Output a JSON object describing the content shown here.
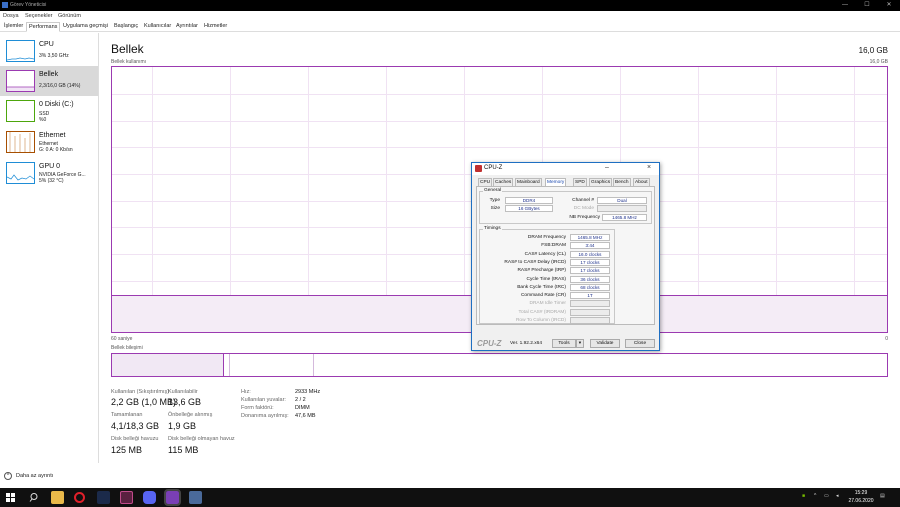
{
  "window": {
    "title": "Görev Yöneticisi",
    "minimize": "—",
    "maximize": "☐",
    "close": "✕"
  },
  "menu": [
    "Dosya",
    "Seçenekler",
    "Görünüm"
  ],
  "tabs": [
    "İşlemler",
    "Performans",
    "Uygulama geçmişi",
    "Başlangıç",
    "Kullanıcılar",
    "Ayrıntılar",
    "Hizmetler"
  ],
  "active_tab": "Performans",
  "sidebar": {
    "items": [
      {
        "title": "CPU",
        "sub1": "3%  3,50 GHz",
        "sub2": "",
        "sub3": "",
        "color": "#1f8dd6"
      },
      {
        "title": "Bellek",
        "sub1": "2,3/16,0 GB (14%)",
        "sub2": "",
        "sub3": "",
        "color": "#9b3ab1"
      },
      {
        "title": "0 Diski (C:)",
        "sub1": "SSD",
        "sub2": "%0",
        "sub3": "",
        "color": "#4da60c"
      },
      {
        "title": "Ethernet",
        "sub1": "Ethernet",
        "sub2": "G: 0  A: 0 Kb/sn",
        "sub3": "",
        "color": "#a74f01"
      },
      {
        "title": "GPU 0",
        "sub1": "NVIDIA GeForce G...",
        "sub2": "5% (32 °C)",
        "sub3": "",
        "color": "#1f8dd6"
      }
    ]
  },
  "main": {
    "title": "Bellek",
    "total": "16,0 GB",
    "usage_label": "Bellek kullanımı",
    "usage_max": "16,0 GB",
    "time_label": "60 saniye",
    "zero_label": "0",
    "composition_label": "Bellek bileşimi",
    "usage_fraction": 0.14
  },
  "stats": {
    "in_use_label": "Kullanılan (Sıkıştırılmış)",
    "in_use": "2,2 GB (1,0 MB)",
    "available_label": "Kullanılabilir",
    "available": "13,6 GB",
    "committed_label": "Tamamlanan",
    "committed": "4,1/18,3 GB",
    "cached_label": "Önbelleğe alınmış",
    "cached": "1,9 GB",
    "paged_label": "Disk belleği havuzu",
    "paged": "125 MB",
    "nonpaged_label": "Disk belleği olmayan havuz",
    "nonpaged": "115 MB"
  },
  "specs": [
    {
      "k": "Hız:",
      "v": "2933 MHz"
    },
    {
      "k": "Kullanılan yuvalar:",
      "v": "2 / 2"
    },
    {
      "k": "Form faktörü:",
      "v": "DIMM"
    },
    {
      "k": "Donanıma ayrılmış:",
      "v": "47,6 MB"
    }
  ],
  "fewer_details": "Daha az ayrıntı",
  "cpuz": {
    "title": "CPU-Z",
    "tabs": [
      "CPU",
      "Caches",
      "Mainboard",
      "Memory",
      "SPD",
      "Graphics",
      "Bench",
      "About"
    ],
    "active_tab": "Memory",
    "general_label": "General",
    "type_label": "Type",
    "type": "DDR4",
    "size_label": "Size",
    "size": "16 GBytes",
    "channel_label": "Channel #",
    "channel": "Dual",
    "dc_label": "DC Mode",
    "dc": "",
    "nb_label": "NB Frequency",
    "nb": "1465.8 MHz",
    "timings_label": "Timings",
    "timings": [
      {
        "k": "DRAM Frequency",
        "v": "1465.8 MHz",
        "dim": false
      },
      {
        "k": "FSB:DRAM",
        "v": "3:44",
        "dim": false
      },
      {
        "k": "CAS# Latency (CL)",
        "v": "16.0 clocks",
        "dim": false
      },
      {
        "k": "RAS# to CAS# Delay (tRCD)",
        "v": "17 clocks",
        "dim": false
      },
      {
        "k": "RAS# Precharge (tRP)",
        "v": "17 clocks",
        "dim": false
      },
      {
        "k": "Cycle Time (tRAS)",
        "v": "36 clocks",
        "dim": false
      },
      {
        "k": "Bank Cycle Time (tRC)",
        "v": "68 clocks",
        "dim": false
      },
      {
        "k": "Command Rate (CR)",
        "v": "1T",
        "dim": false
      },
      {
        "k": "DRAM Idle Timer",
        "v": "",
        "dim": true
      },
      {
        "k": "Total CAS# (tRDRAM)",
        "v": "",
        "dim": true
      },
      {
        "k": "Row To Column (tRCD)",
        "v": "",
        "dim": true
      }
    ],
    "logo": "CPU-Z",
    "version": "Ver. 1.92.2.x64",
    "tools": "Tools",
    "validate": "Validate",
    "close": "Close"
  },
  "taskbar": {
    "time": "15:29",
    "date": "27.06.2020"
  }
}
